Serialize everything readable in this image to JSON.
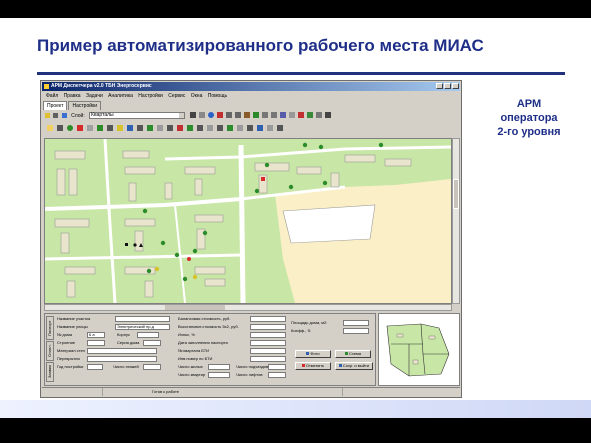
{
  "slide": {
    "title": "Пример автоматизированного рабочего места МИАС",
    "caption": [
      "АРМ",
      "оператора",
      "2-го уровня"
    ]
  },
  "app": {
    "window_title": "АРМ Диспетчера v2.0 ТБН Энергосервис",
    "menu": [
      "Файл",
      "Правка",
      "Задачи",
      "Аналитика",
      "Настройки",
      "Сервис",
      "Окна",
      "Помощь"
    ],
    "tabs": [
      "Проект",
      "Настройки"
    ],
    "layer_label": "Слой:",
    "layer_value": "Кварталы",
    "vertical_tabs": [
      "Паспорт",
      "Отопл.",
      "Заявки"
    ],
    "form": {
      "col1": [
        {
          "label": "Название участка",
          "value": ""
        },
        {
          "label": "Название улицы",
          "value": "Электрический пр-д"
        },
        {
          "label": "№ дома",
          "value": "6 а"
        },
        {
          "label": "Строение",
          "value": ""
        },
        {
          "label": "Материал стен",
          "value": ""
        },
        {
          "label": "Перекрытия",
          "value": ""
        },
        {
          "label": "Год постройки",
          "value": ""
        }
      ],
      "corpus_label": "Корпус",
      "series_label": "Серия дома",
      "stories_label": "Число этажей",
      "col2": [
        {
          "label": "Балансовая стоимость, руб.",
          "value": ""
        },
        {
          "label": "Восстановит.стоимость 5х2, руб.",
          "value": ""
        },
        {
          "label": "Износ, %",
          "value": ""
        },
        {
          "label": "Дата заполнения паспорта",
          "value": ""
        },
        {
          "label": "№ квартала БТИ",
          "value": ""
        },
        {
          "label": "Инв.номер по БТИ",
          "value": ""
        },
        {
          "label": "Число жилых",
          "value": ""
        },
        {
          "label": "Число квартир",
          "value": ""
        }
      ],
      "podezd_label": "Число подъездов",
      "lifts_label": "Число лифтов",
      "area_label": "Площадь дома, м2:",
      "coef_label": "Коэфф., S:",
      "buttons": {
        "photo": "Фото",
        "scheme": "Схема",
        "cancel": "Отменить",
        "save_exit": "Сохр. и выйти"
      }
    },
    "status_text": "Готов к работе"
  },
  "colors": {
    "title": "#1f2f88",
    "map_green": "#c8e6a6",
    "map_sand": "#fbefc7",
    "map_white": "#ffffff"
  }
}
